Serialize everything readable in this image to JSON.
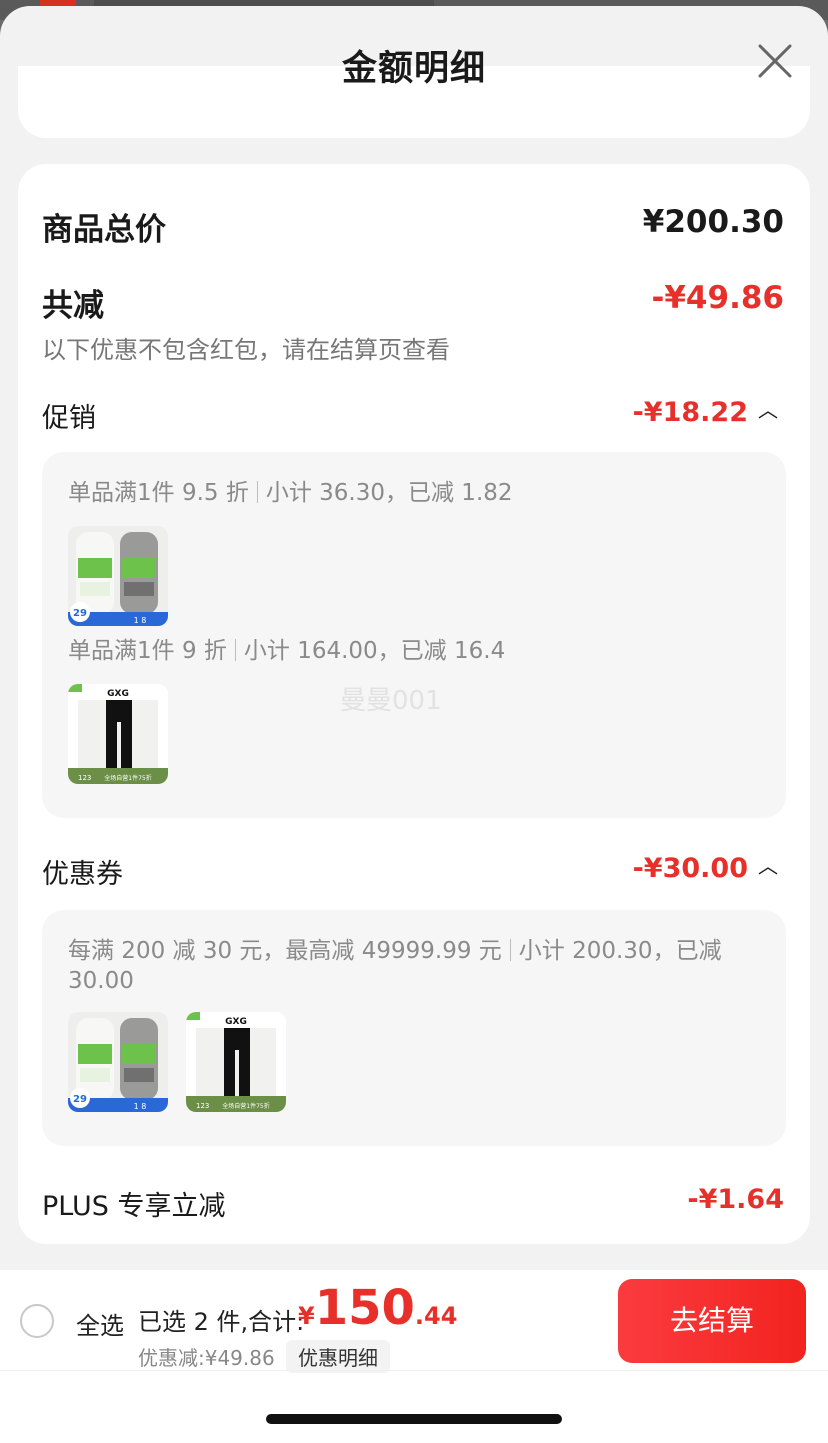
{
  "sheet": {
    "title": "金额明细"
  },
  "summary": {
    "goods_total_label": "商品总价",
    "goods_total_value": "¥200.30",
    "total_reduce_label": "共减",
    "total_reduce_value": "-¥49.86",
    "note": "以下优惠不包含红包，请在结算页查看"
  },
  "promotion": {
    "label": "促销",
    "amount": "-¥18.22",
    "rule1": {
      "name": "单品满1件 9.5 折",
      "detail": "小计 36.30，已减 1.82"
    },
    "rule2": {
      "name": "单品满1件 9 折",
      "detail": "小计 164.00，已减 16.4"
    }
  },
  "coupon": {
    "label": "优惠券",
    "amount": "-¥30.00",
    "rule": {
      "name": "每满 200 减 30 元，最高减 49999.99 元",
      "detail_line1": "小计 200.30，已减",
      "detail_line2": "30.00"
    }
  },
  "plus": {
    "label": "PLUS 专享立减",
    "amount": "-¥1.64"
  },
  "watermark": "曼曼001",
  "products": {
    "socks": {
      "price_tag": "29",
      "promo_text": "1 8"
    },
    "pants": {
      "brand": "GXG",
      "tag": "123",
      "banner": "全场自营1件75折"
    }
  },
  "bottom": {
    "select_all": "全选",
    "selected": "已选 2 件,合计:",
    "currency": "¥",
    "total_int": "150",
    "total_dec": ".44",
    "discount": "优惠减:¥49.86",
    "detail_button": "优惠明细",
    "checkout": "去结算"
  },
  "colors": {
    "accent_red": "#e8302a",
    "button_red": "#f52a2a"
  },
  "icons": {
    "close": "close-icon",
    "caret": "chevron-up-icon"
  }
}
